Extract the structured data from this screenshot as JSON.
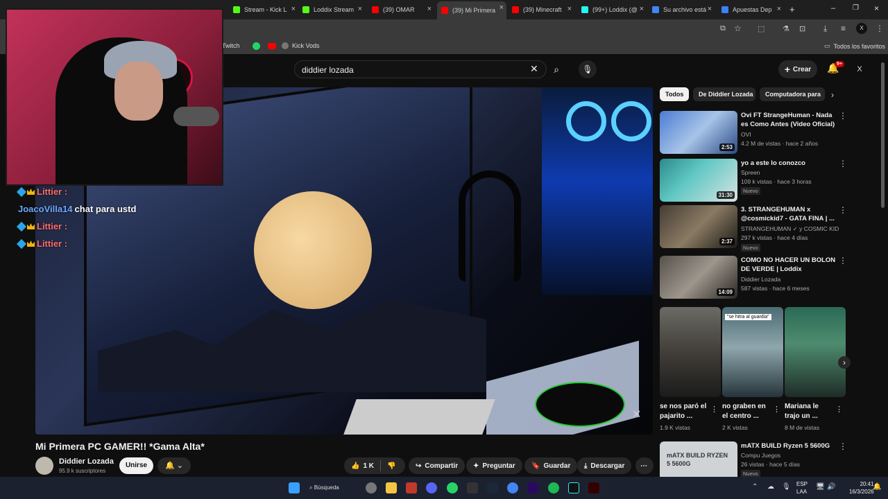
{
  "browser": {
    "tabs": [
      {
        "label": "Stream - Kick L",
        "color": "#53fc18"
      },
      {
        "label": "Loddix Stream",
        "color": "#53fc18"
      },
      {
        "label": "(39) OMAR",
        "color": "#ff0000"
      },
      {
        "label": "(39) Mi Primera",
        "color": "#ff0000"
      },
      {
        "label": "(39) Minecraft",
        "color": "#ff0000"
      },
      {
        "label": "(99+) Loddix (@",
        "color": "#25f4ee"
      },
      {
        "label": "Su archivo está",
        "color": "#4285f4"
      },
      {
        "label": "Apuestas Dep",
        "color": "#3b82f6"
      }
    ],
    "bookmarks": [
      "Twitch",
      "Kick Vods"
    ],
    "all_favorites": "Todos los favoritos"
  },
  "youtube": {
    "search_value": "diddier lozada",
    "create_label": "Crear",
    "notif_badge": "9+"
  },
  "webcam_chat": [
    {
      "user": "Littier :",
      "color": "#ff6f6f",
      "msg": ""
    },
    {
      "user": "JoacoVilla14",
      "color": "#6fa8ff",
      "msg": "chat para ustd"
    },
    {
      "user": "Littier :",
      "color": "#ff6f6f",
      "msg": ""
    },
    {
      "user": "Littier :",
      "color": "#ff6f6f",
      "msg": ""
    }
  ],
  "video": {
    "title": "Mi Primera PC GAMER!! *Gama Alta*",
    "channel": "Diddier Lozada",
    "subscribers": "95.9 k suscriptores",
    "join_label": "Unirse",
    "likes": "1 K",
    "share": "Compartir",
    "ask": "Preguntar",
    "save": "Guardar",
    "download": "Descargar"
  },
  "chips": [
    "Todos",
    "De Diddier Lozada",
    "Computadora para"
  ],
  "recommendations": [
    {
      "title": "Ovi FT StrangeHuman - Nada es Como Antes (Video Oficial) ...",
      "channel": "OVI",
      "meta": "4.2 M de vistas · hace 2 años",
      "duration": "2:53",
      "new": ""
    },
    {
      "title": "yo a este lo conozco",
      "channel": "Spreen",
      "meta": "109 k vistas · hace 3 horas",
      "duration": "31:30",
      "new": "Nuevo"
    },
    {
      "title": "3. STRANGEHUMAN x @cosmickid7 - GATA FINA | ...",
      "channel": "STRANGEHUMAN ✓ y COSMIC KID",
      "meta": "297 k vistas · hace 4 días",
      "duration": "2:37",
      "new": "Nuevo"
    },
    {
      "title": "COMO NO HACER UN BOLON DE VERDE | Loddix",
      "channel": "Diddier Lozada",
      "meta": "587 vistas · hace 6 meses",
      "duration": "14:09",
      "new": ""
    }
  ],
  "shorts": [
    {
      "title": "se nos paró el pajarito ...",
      "views": "1.9 K vistas"
    },
    {
      "title": "no graben en el centro ...",
      "views": "2 K vistas",
      "caption": "\"se hitra al guardia\""
    },
    {
      "title": "Mariana le trajo un ...",
      "views": "8 M de vistas"
    }
  ],
  "last_rec": {
    "title": "mATX BUILD Ryzen 5 5600G",
    "thumb_text": "mATX BUILD RYZEN 5 5600G",
    "channel": "Compu Juegos",
    "meta": "26 vistas · hace 5 días",
    "new": "Nuevo"
  },
  "taskbar": {
    "search": "Búsqueda",
    "lang1": "ESP",
    "lang2": "LAA",
    "time": "20:41",
    "date": "16/3/2026"
  }
}
